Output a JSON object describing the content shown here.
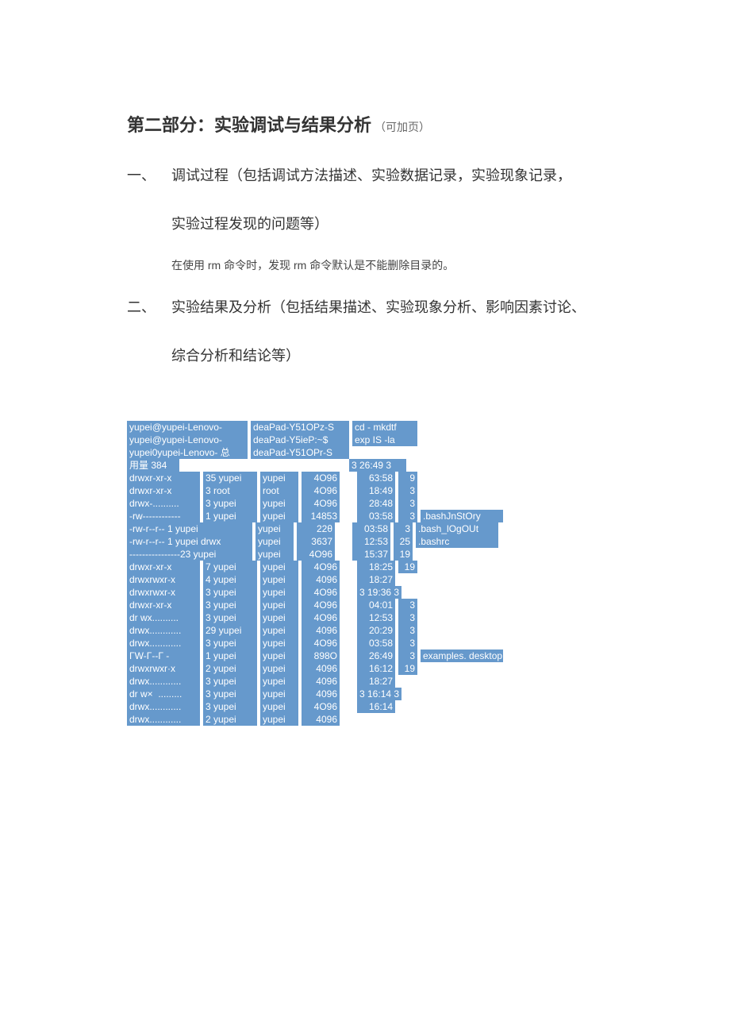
{
  "title_main": "第二部分：实验调试与结果分析",
  "title_sub": "（可加页）",
  "section1_num": "一、",
  "section1_body1": "调试过程（包括调试方法描述、实验数据记录，实验现象记录，",
  "section1_body2": "实验过程发现的问题等）",
  "note_pre": "在使用 ",
  "note_rm1": "rm",
  "note_mid": " 命令时，发现 ",
  "note_rm2": "rm",
  "note_tail": " 命令默认是不能删除目录的。",
  "section2_num": "二、",
  "section2_body1": "实验结果及分析（包括结果描述、实验现象分析、影响因素讨论、",
  "section2_body2": "综合分析和结论等）",
  "term": {
    "hdr": [
      [
        "yupei@yupei-Lenovo-",
        "deaPad-Y51OPz-S",
        "cd - mkdtf"
      ],
      [
        "yupei@yupei-Lenovo-",
        "deaPad-Y5ieP:~$",
        "exp IS -la"
      ],
      [
        "yupei0yupei-Lenovo- 总",
        "deaPad-Y51OPr-S",
        ""
      ]
    ],
    "total": "用量 384",
    "rows": [
      {
        "perm": "drwxr-xr-x",
        "n": "35 yupei",
        "u": "yupei",
        "sz": "4O96",
        "t": "63:58",
        "k": "9",
        "f": ""
      },
      {
        "perm": "drwxr-xr-x",
        "n": "3 root",
        "u": "root",
        "sz": "4O96",
        "t": "18:49",
        "k": "3",
        "f": ""
      },
      {
        "perm": "drwx-..........",
        "n": "3 yupei",
        "u": "yupei",
        "sz": "4O96",
        "t": "28:48",
        "k": "3",
        "f": ""
      },
      {
        "perm": "-rw------------",
        "n": "1 yupei",
        "u": "yupei",
        "sz": "14853",
        "t": "03:58",
        "k": "3",
        "f": ".bashJnStOry"
      },
      {
        "perm": "-rw-r--r-- 1 yupei",
        "n": "",
        "u": "yupei",
        "sz": "22θ",
        "t": "03:58",
        "k": "3",
        "f": ".bash_lOgOUt"
      },
      {
        "perm": "-rw-r--r-- 1 yupei drwx",
        "n": "",
        "u": "yupei",
        "sz": "3637",
        "t": "12:53",
        "k": "25",
        "f": ".bashrc"
      },
      {
        "perm": "----------------23 yupei",
        "n": "",
        "u": "yupei",
        "sz": "4O96",
        "t": "15:37",
        "k": "19",
        "f": ""
      },
      {
        "perm": "drwxr-xr-x",
        "n": "7 yupei",
        "u": "yupei",
        "sz": "4O96",
        "t": "18:25",
        "k": "19",
        "f": ""
      },
      {
        "perm": "drwxrwxr-x",
        "n": "4 yupei",
        "u": "yupei",
        "sz": "4096",
        "t": "18:27",
        "k": "",
        "f": ""
      },
      {
        "perm": "drwxrwxr-x",
        "n": "3 yupei",
        "u": "yupei",
        "sz": "4O96",
        "t": "",
        "k": "3 19:36 3",
        "f": ""
      },
      {
        "perm": "drwxr-xr-x",
        "n": "3 yupei",
        "u": "yupei",
        "sz": "4O96",
        "t": "04:01",
        "k": "3",
        "f": ""
      },
      {
        "perm": "dr wx..........",
        "n": "3 yupei",
        "u": "yupei",
        "sz": "4O96",
        "t": "12:53",
        "k": "3",
        "f": ""
      },
      {
        "perm": "drwx............",
        "n": "29 yupei",
        "u": "yupei",
        "sz": "4096",
        "t": "20:29",
        "k": "3",
        "f": ""
      },
      {
        "perm": "drwx............",
        "n": "3 yupei",
        "u": "yupei",
        "sz": "4O96",
        "t": "03:58",
        "k": "3",
        "f": ""
      },
      {
        "perm": "ΓW-Γ--Γ -",
        "n": "1 yupei",
        "u": "yupei",
        "sz": "898O",
        "t": "26:49",
        "k": "3",
        "f": "examples. desktop"
      },
      {
        "perm": "drwxrwxr·x",
        "n": "2 yupei",
        "u": "yupei",
        "sz": "4096",
        "t": "16:12",
        "k": "19",
        "f": ""
      },
      {
        "perm": "drwx............",
        "n": "3 yupei",
        "u": "yupei",
        "sz": "4096",
        "t": "18:27",
        "k": "",
        "f": ""
      },
      {
        "perm": "dr w×  .........",
        "n": "3 yupei",
        "u": "yupei",
        "sz": "4096",
        "t": "",
        "k": "3 16:14 3",
        "f": ""
      },
      {
        "perm": "drwx............",
        "n": "3 yupei",
        "u": "yupei",
        "sz": "4O96",
        "t": "16:14",
        "k": "",
        "f": ""
      },
      {
        "perm": "drwx............",
        "n": "2 yupei",
        "u": "yupei",
        "sz": "4096",
        "t": "",
        "k": "",
        "f": ""
      }
    ],
    "top_time": "3 26:49 3"
  }
}
